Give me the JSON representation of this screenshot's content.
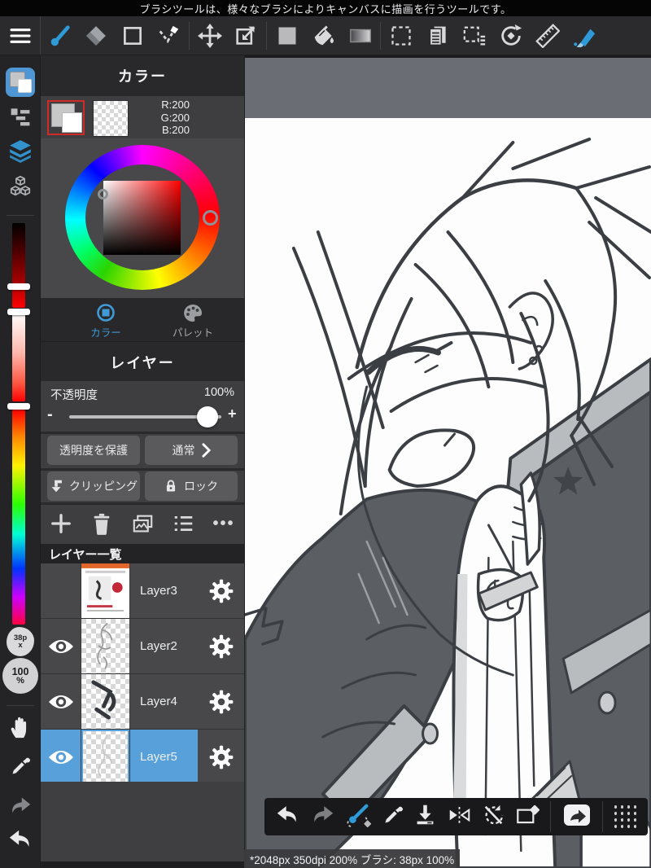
{
  "tooltip_bar": {
    "text": "ブラシツールは、様々なブラシによりキャンバスに描画を行うツールです。"
  },
  "toolbar": {
    "icons": [
      "menu",
      "brush",
      "eraser",
      "rectangle",
      "select-pen",
      "move",
      "transform",
      "color-swatch",
      "fill-bucket",
      "gradient",
      "marquee-select",
      "pages",
      "select-options",
      "rotate-canvas",
      "ruler",
      "snap-brush"
    ]
  },
  "sidebar": {
    "icons": [
      "color-panel",
      "tool-list",
      "layers",
      "materials"
    ],
    "brush_size": "38px",
    "zoom_value": "100",
    "zoom_unit": "%",
    "tools": [
      "hand",
      "eyedropper",
      "redo",
      "undo"
    ]
  },
  "color_panel": {
    "title": "カラー",
    "rgb_r": "R:200",
    "rgb_g": "G:200",
    "rgb_b": "B:200",
    "tabs": [
      {
        "label": "カラー",
        "active": true
      },
      {
        "label": "パレット",
        "active": false
      }
    ]
  },
  "layer_panel": {
    "title": "レイヤー",
    "opacity_label": "不透明度",
    "opacity_value": "100%",
    "minus": "-",
    "plus": "+",
    "protect_label": "透明度を保護",
    "blend_label": "通常",
    "clipping_label": "クリッピング",
    "lock_label": "ロック",
    "list_title": "レイヤー一覧",
    "layers": [
      {
        "name": "Layer3",
        "visible": false,
        "selected": false,
        "thumb": "page"
      },
      {
        "name": "Layer2",
        "visible": true,
        "selected": false,
        "thumb": "sketch"
      },
      {
        "name": "Layer4",
        "visible": true,
        "selected": false,
        "thumb": "ink"
      },
      {
        "name": "Layer5",
        "visible": true,
        "selected": true,
        "thumb": "faint"
      }
    ]
  },
  "bottom_toolbar": {
    "icons": [
      "undo",
      "redo",
      "brush-toggle",
      "eyedropper",
      "save",
      "flip-horizontal",
      "rotate-reset",
      "clear",
      "share",
      "drag-handle"
    ]
  },
  "status_bar": {
    "text": "*2048px 350dpi 200% ブラシ: 38px 100%"
  },
  "colors": {
    "selection_blue": "#57a0d9",
    "tool_blue": "#2e9ad8",
    "current_rgb": "#c8c8c8",
    "canvas_outside": "#6a6e74"
  }
}
